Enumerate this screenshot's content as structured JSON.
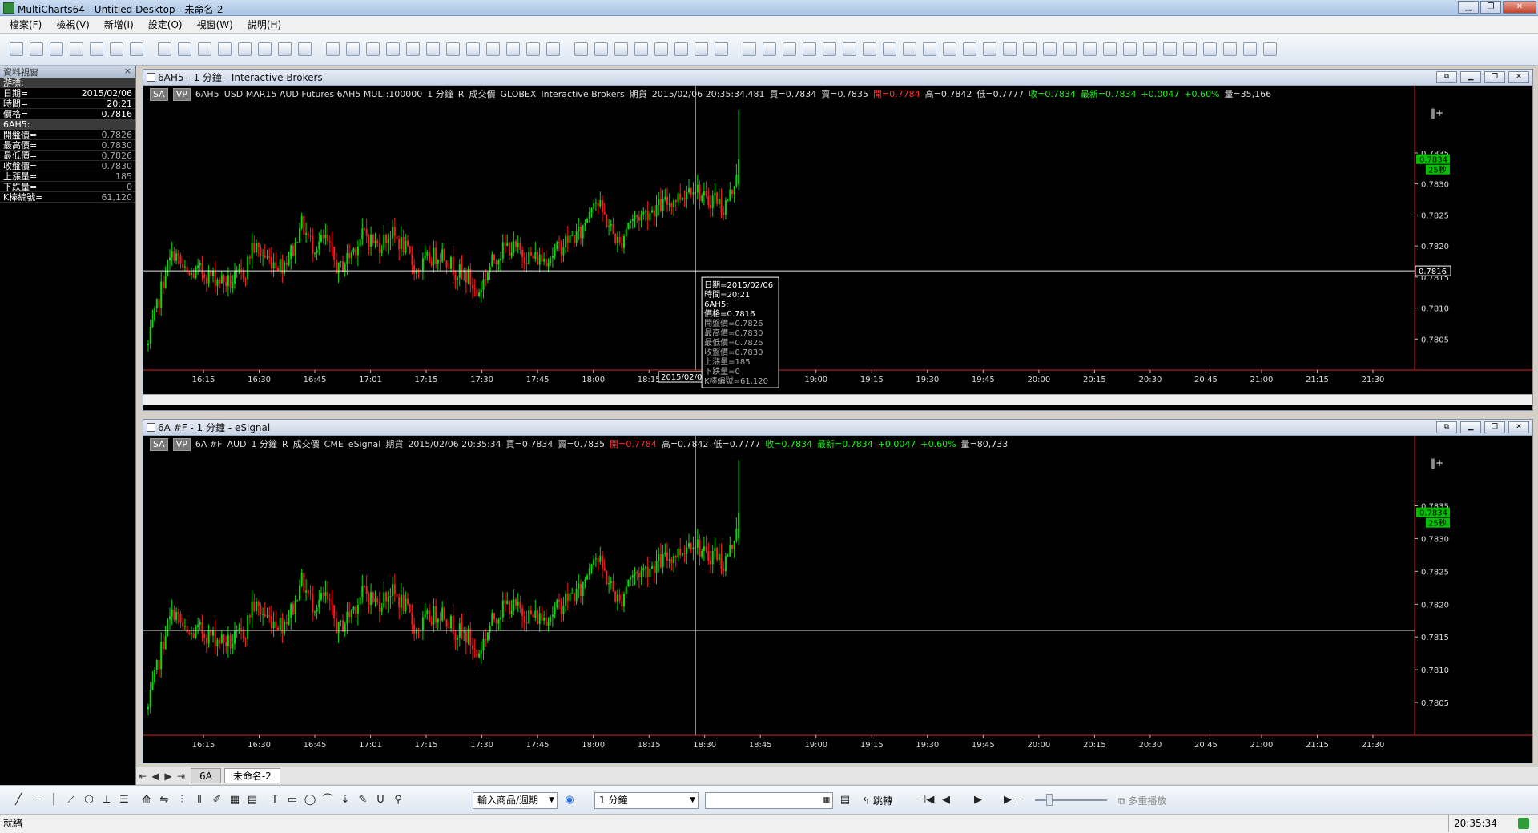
{
  "window": {
    "title": "MultiCharts64 - Untitled Desktop - 未命名-2",
    "min": "▁",
    "max": "❐",
    "close": "✕"
  },
  "menu": [
    "檔案(F)",
    "檢視(V)",
    "新增(I)",
    "設定(O)",
    "視窗(W)",
    "說明(H)"
  ],
  "data_window": {
    "title": "資料視窗",
    "close": "×",
    "cursor_label": "游標:",
    "cursor_rows": [
      {
        "k": "日期=",
        "v": "2015/02/06"
      },
      {
        "k": "時間=",
        "v": "20:21"
      },
      {
        "k": "價格=",
        "v": "0.7816"
      }
    ],
    "symbol_label": "6AH5:",
    "symbol_rows": [
      {
        "k": "開盤價=",
        "v": "0.7826"
      },
      {
        "k": "最高價=",
        "v": "0.7830"
      },
      {
        "k": "最低價=",
        "v": "0.7826"
      },
      {
        "k": "收盤價=",
        "v": "0.7830"
      },
      {
        "k": "上漲量=",
        "v": "185"
      },
      {
        "k": "下跌量=",
        "v": "0"
      },
      {
        "k": "K棒編號=",
        "v": "61,120"
      }
    ]
  },
  "panes": [
    {
      "title": "6AH5 - 1 分鐘 - Interactive Brokers",
      "info": {
        "sa": "SA",
        "vp": "VP",
        "symbol": "6AH5",
        "desc": "USD MAR15 AUD Futures 6AH5 MULT:100000",
        "interval": "1 分鐘",
        "r": "R",
        "field": "成交價",
        "exchange": "GLOBEX",
        "feed": "Interactive Brokers",
        "type": "期貨",
        "datetime": "2015/02/06  20:35:34.481",
        "bid": "買=0.7834",
        "ask": "賣=0.7835",
        "open": "開=0.7784",
        "high": "高=0.7842",
        "low": "低=0.7777",
        "close": "收=0.7834",
        "last": "最新=0.7834",
        "chg": "+0.0047",
        "pct": "+0.60%",
        "vol": "量=35,166"
      },
      "yticks": [
        "0.7835",
        "0.7830",
        "0.7825",
        "0.7820",
        "0.7815",
        "0.7810",
        "0.7805"
      ],
      "price_tag": "0.7834",
      "timer_tag": "25秒",
      "cursor_tag": "0.7816",
      "date_tag": "2015/02/06",
      "tooltip": [
        "日期=2015/02/06",
        "時間=20:21",
        "6AH5:",
        "價格=0.7816",
        "開盤價=0.7826",
        "最高價=0.7830",
        "最低價=0.7826",
        "收盤價=0.7830",
        "上漲量=185",
        "下跌量=0",
        "K棒編號=61,120"
      ]
    },
    {
      "title": "6A #F - 1 分鐘 - eSignal",
      "info": {
        "sa": "SA",
        "vp": "VP",
        "symbol": "6A #F",
        "desc": "AUD",
        "interval": "1 分鐘",
        "r": "R",
        "field": "成交價",
        "exchange": "CME",
        "feed": "eSignal",
        "type": "期貨",
        "datetime": "2015/02/06  20:35:34",
        "bid": "買=0.7834",
        "ask": "賣=0.7835",
        "open": "開=0.7784",
        "high": "高=0.7842",
        "low": "低=0.7777",
        "close": "收=0.7834",
        "last": "最新=0.7834",
        "chg": "+0.0047",
        "pct": "+0.60%",
        "vol": "量=80,733"
      },
      "yticks": [
        "0.7835",
        "0.7830",
        "0.7825",
        "0.7820",
        "0.7815",
        "0.7810",
        "0.7805"
      ],
      "price_tag": "0.7834",
      "timer_tag": "25秒"
    }
  ],
  "xticks": [
    "16:15",
    "16:30",
    "16:45",
    "17:01",
    "17:15",
    "17:30",
    "17:45",
    "18:00",
    "18:15",
    "18:30",
    "18:45",
    "19:00",
    "19:15",
    "19:30",
    "19:45",
    "20:00",
    "20:15",
    "20:30",
    "20:45",
    "21:00",
    "21:15",
    "21:30"
  ],
  "chart_data": {
    "type": "candlestick",
    "xticks": [
      "16:15",
      "16:30",
      "16:45",
      "17:01",
      "17:15",
      "17:30",
      "17:45",
      "18:00",
      "18:15",
      "18:30",
      "18:45",
      "19:00",
      "19:15",
      "19:30",
      "19:45",
      "20:00",
      "20:15",
      "20:30",
      "20:45",
      "21:00",
      "21:15",
      "21:30"
    ],
    "ylim": [
      0.78,
      0.7843
    ],
    "cursor_price": 0.7816,
    "last_price": 0.7834,
    "anchors": [
      [
        0,
        0.7804
      ],
      [
        4,
        0.781
      ],
      [
        8,
        0.7816
      ],
      [
        12,
        0.7819
      ],
      [
        18,
        0.7815
      ],
      [
        24,
        0.7816
      ],
      [
        30,
        0.7815
      ],
      [
        38,
        0.7814
      ],
      [
        45,
        0.7816
      ],
      [
        48,
        0.782
      ],
      [
        55,
        0.7818
      ],
      [
        62,
        0.7817
      ],
      [
        68,
        0.782
      ],
      [
        70,
        0.7824
      ],
      [
        76,
        0.782
      ],
      [
        82,
        0.7821
      ],
      [
        88,
        0.7816
      ],
      [
        94,
        0.7819
      ],
      [
        100,
        0.7822
      ],
      [
        106,
        0.782
      ],
      [
        112,
        0.7822
      ],
      [
        118,
        0.782
      ],
      [
        124,
        0.7816
      ],
      [
        130,
        0.7818
      ],
      [
        136,
        0.7819
      ],
      [
        142,
        0.7816
      ],
      [
        148,
        0.7815
      ],
      [
        152,
        0.7812
      ],
      [
        157,
        0.7816
      ],
      [
        160,
        0.7818
      ],
      [
        166,
        0.782
      ],
      [
        172,
        0.7819
      ],
      [
        178,
        0.7818
      ],
      [
        183,
        0.7818
      ],
      [
        188,
        0.7819
      ],
      [
        194,
        0.7821
      ],
      [
        200,
        0.7822
      ],
      [
        206,
        0.7828
      ],
      [
        212,
        0.7824
      ],
      [
        218,
        0.782
      ],
      [
        222,
        0.7824
      ],
      [
        228,
        0.7825
      ],
      [
        234,
        0.7826
      ],
      [
        240,
        0.7827
      ],
      [
        246,
        0.7828
      ],
      [
        252,
        0.783
      ],
      [
        258,
        0.7827
      ],
      [
        262,
        0.7828
      ],
      [
        266,
        0.7826
      ],
      [
        270,
        0.7829
      ],
      [
        273,
        0.7834
      ]
    ],
    "last_candle": {
      "open": 0.783,
      "high": 0.7842,
      "low": 0.7829,
      "close": 0.7834
    }
  },
  "tabs": {
    "nav": [
      "⇤",
      "◀",
      "▶",
      "⇥"
    ],
    "items": [
      "6A",
      "未命名-2"
    ]
  },
  "drawbar": {
    "tools": [
      "╱",
      "─",
      "│",
      "⟋",
      "⬡",
      "⟂",
      "☰",
      "⟰",
      "⇋",
      "⫶",
      "⫴",
      "✐",
      "▦",
      "▤",
      "T",
      "▭",
      "◯",
      "⌒",
      "⇣",
      "✎",
      "U",
      "⚲"
    ],
    "symbol_select": "輸入商品/週期",
    "interval_select": "1 分鐘",
    "jump": "跳轉",
    "playback": "多重播放",
    "play_controls": [
      "⊣◀",
      "◀",
      "▶",
      "▶⊢"
    ]
  },
  "status": {
    "text": "就緒",
    "clock": "20:35:34"
  },
  "colors": {
    "up": "#00e000",
    "down": "#ff1a1a",
    "bg": "#000000",
    "axis_red": "#e02020",
    "tag_green": "#00c000"
  }
}
